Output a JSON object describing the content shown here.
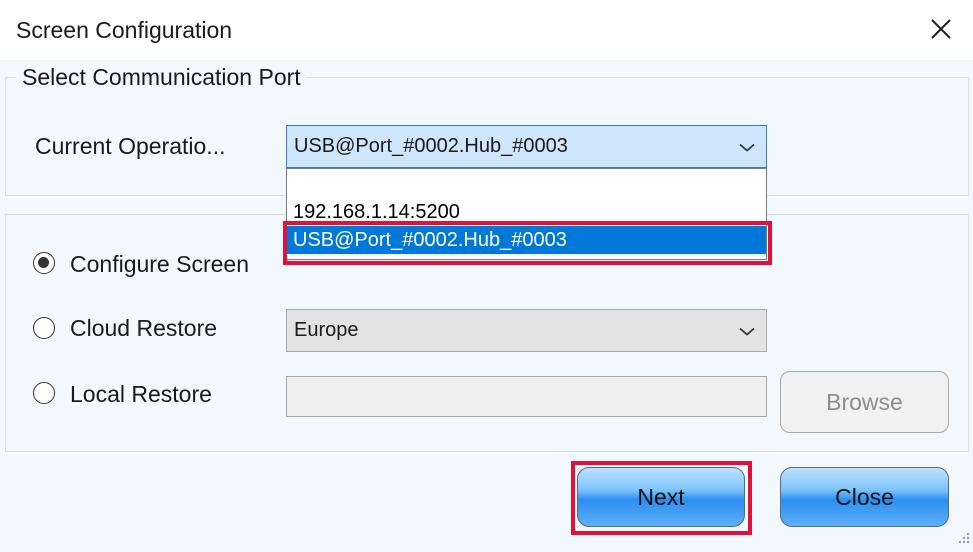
{
  "window": {
    "title": "Screen Configuration"
  },
  "port_group": {
    "legend": "Select Communication Port",
    "current_operation_label": "Current Operatio...",
    "current_port": "USB@Port_#0002.Hub_#0003",
    "options": [
      "192.168.1.14:5200",
      "USB@Port_#0002.Hub_#0003"
    ]
  },
  "mode_group": {
    "configure_screen_label": "Configure Screen",
    "cloud_restore_label": "Cloud Restore",
    "cloud_region": "Europe",
    "local_restore_label": "Local Restore",
    "local_path": "",
    "browse_label": "Browse",
    "selected_mode": "Configure Screen"
  },
  "footer": {
    "next_label": "Next",
    "close_label": "Close"
  },
  "colors": {
    "selection": "#0078d7",
    "highlight": "#e0123a",
    "accent_border": "#2f7fd1"
  }
}
